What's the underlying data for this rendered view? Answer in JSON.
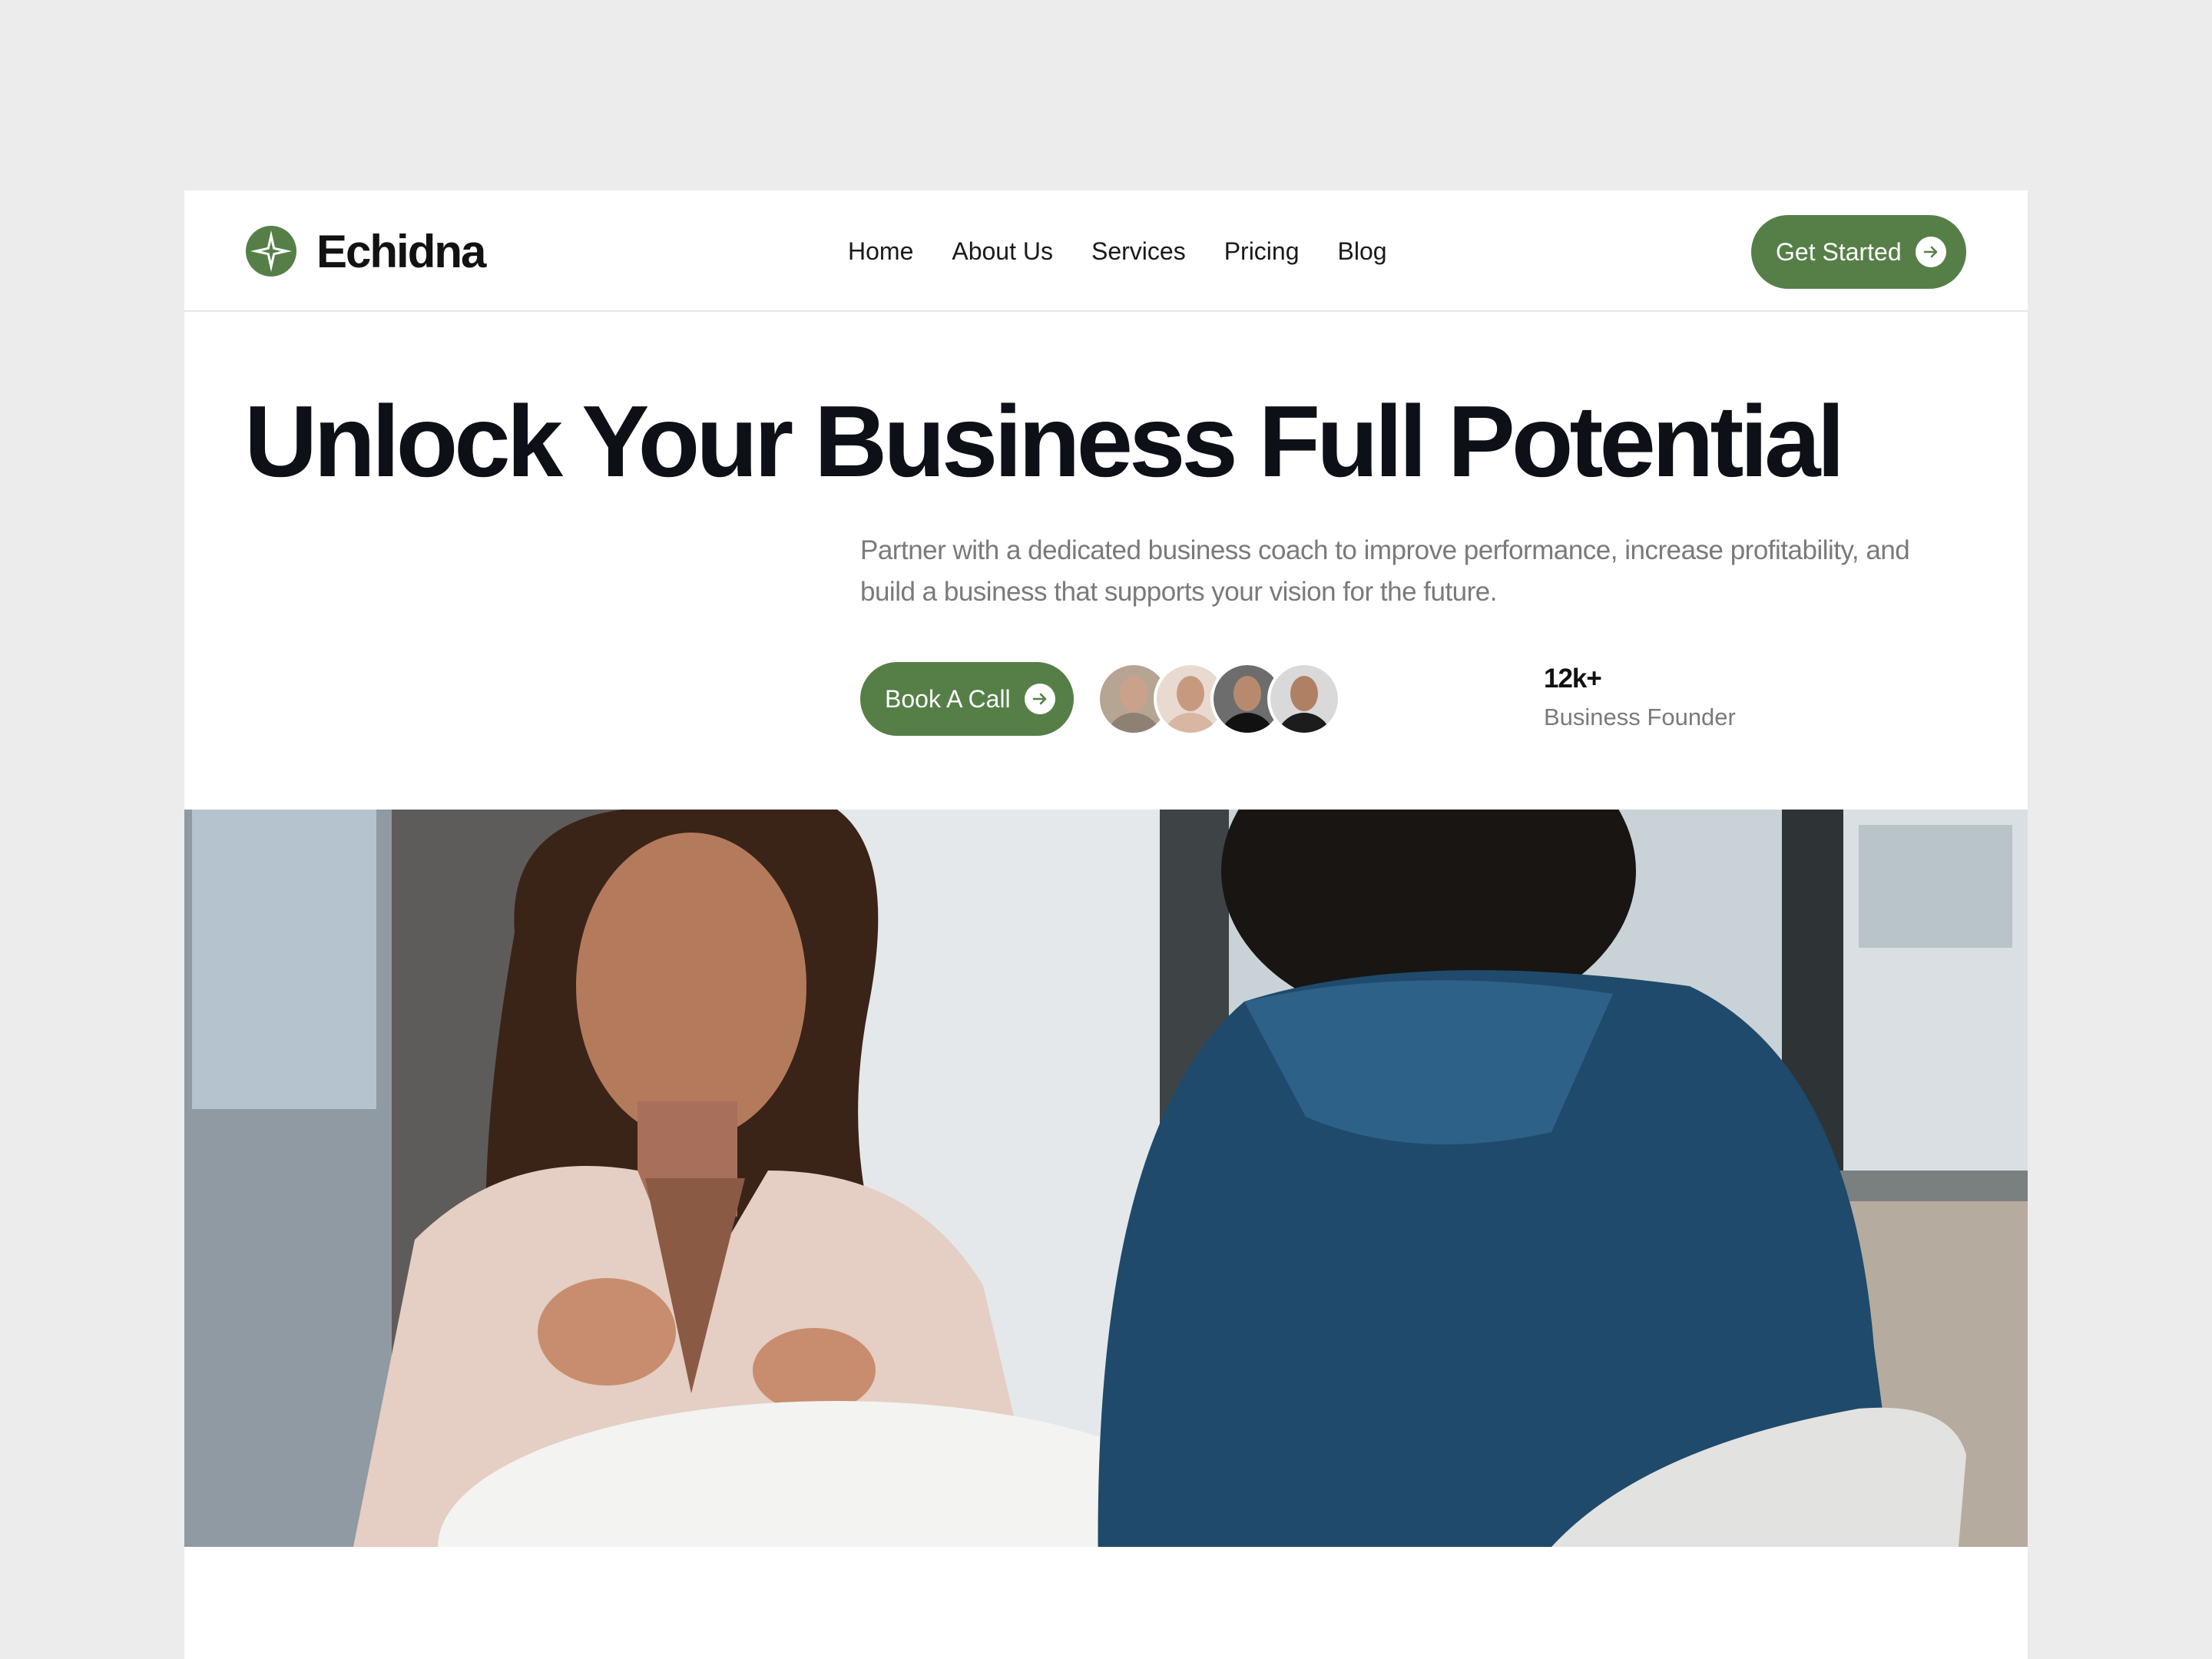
{
  "brand": {
    "name": "Echidna",
    "icon": "compass-star-icon",
    "accent_color": "#567f48"
  },
  "nav": {
    "items": [
      {
        "label": "Home"
      },
      {
        "label": "About Us"
      },
      {
        "label": "Services"
      },
      {
        "label": "Pricing"
      },
      {
        "label": "Blog"
      }
    ]
  },
  "header": {
    "cta_label": "Get Started",
    "cta_icon": "arrow-right-icon"
  },
  "hero": {
    "title": "Unlock Your Business Full Potential",
    "subtitle": "Partner with a dedicated business coach to improve performance, increase profitability, and build a business that supports your vision for the future.",
    "cta_label": "Book A Call",
    "cta_icon": "arrow-right-icon",
    "social_proof": {
      "count": "12k+",
      "label": "Business Founder",
      "avatars": [
        "avatar-1",
        "avatar-2",
        "avatar-3",
        "avatar-4"
      ]
    },
    "image": "two-women-meeting-photo"
  }
}
